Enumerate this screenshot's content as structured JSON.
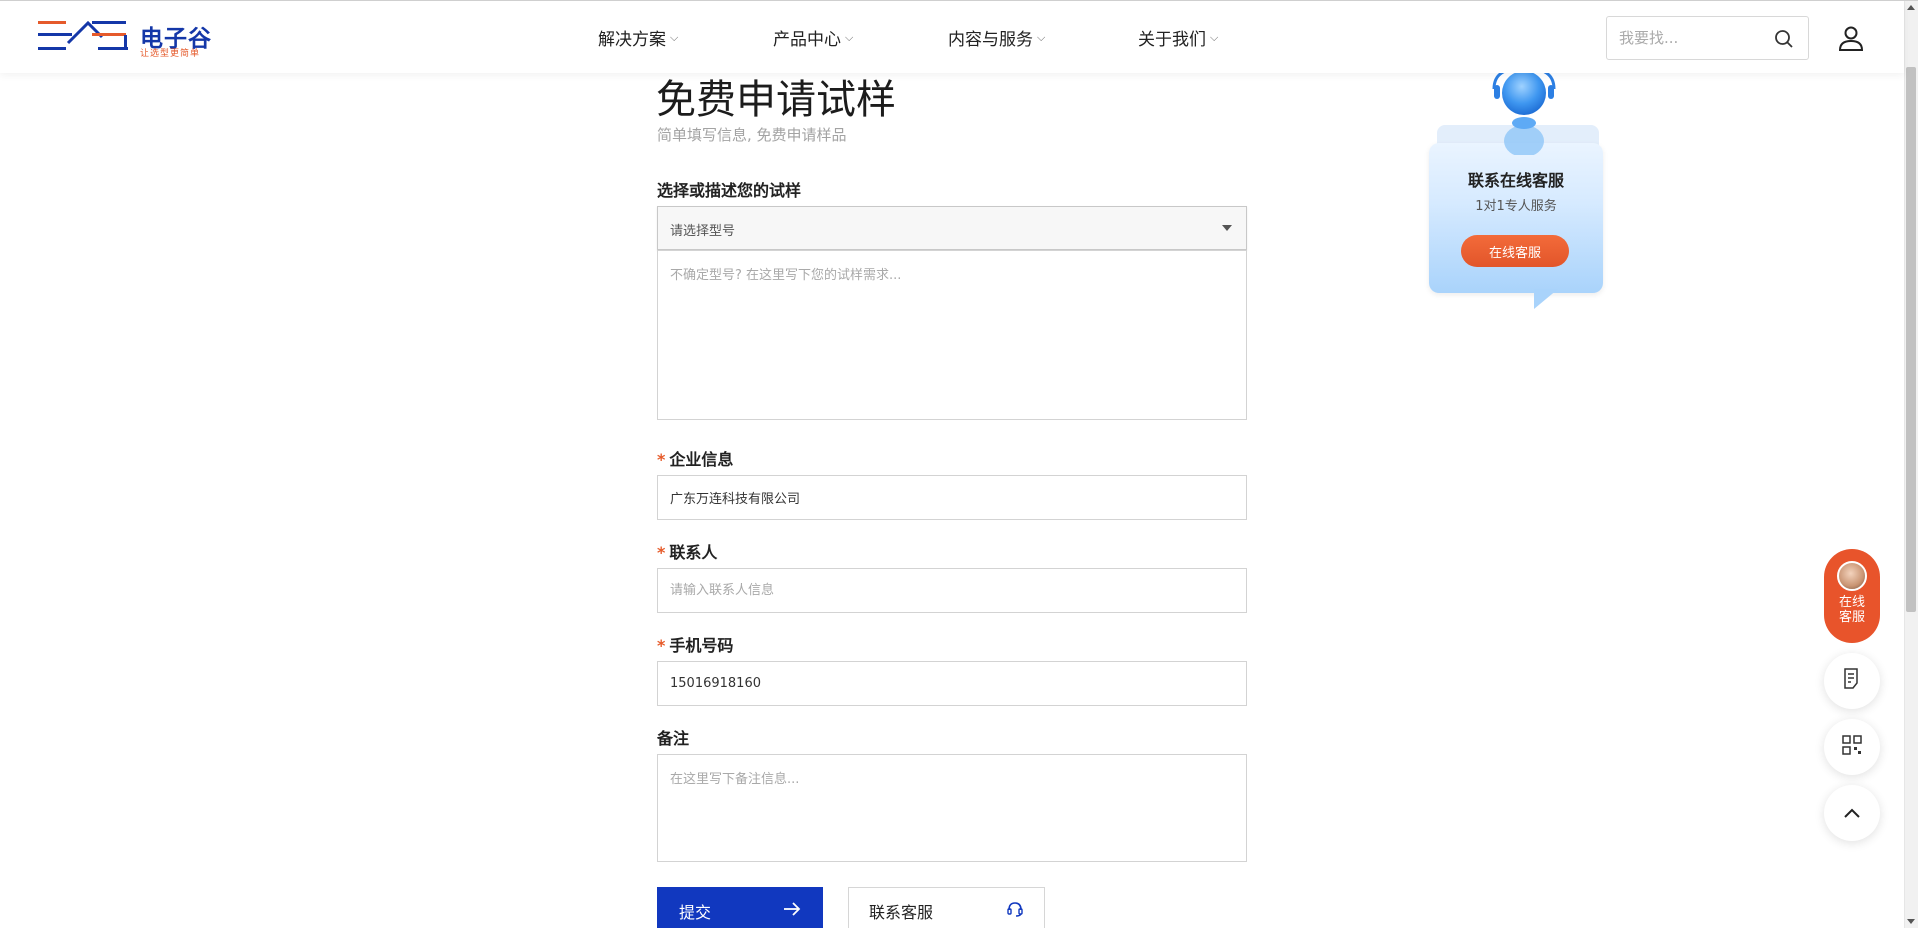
{
  "header": {
    "logo_text": "电子谷",
    "logo_slogan": "让选型更简单",
    "nav": [
      {
        "label": "解决方案"
      },
      {
        "label": "产品中心"
      },
      {
        "label": "内容与服务"
      },
      {
        "label": "关于我们"
      }
    ],
    "search": {
      "placeholder": "我要找..."
    },
    "colors": {
      "brand_blue": "#1437a8",
      "brand_orange": "#e55a2b"
    }
  },
  "main": {
    "title": "免费申请试样",
    "subtitle": "简单填写信息, 免费申请样品",
    "sample": {
      "label": "选择或描述您的试样",
      "select_value": "请选择型号",
      "textarea_placeholder": "不确定型号? 在这里写下您的试样需求..."
    },
    "company": {
      "required_mark": "*",
      "label": "企业信息",
      "value": "广东万连科技有限公司"
    },
    "contact": {
      "required_mark": "*",
      "label": "联系人",
      "placeholder": "请输入联系人信息"
    },
    "phone": {
      "required_mark": "*",
      "label": "手机号码",
      "value": "15016918160"
    },
    "remark": {
      "label": "备注",
      "placeholder": "在这里写下备注信息..."
    },
    "submit_label": "提交",
    "contact_btn_label": "联系客服"
  },
  "service_card": {
    "title": "联系在线客服",
    "subtitle": "1对1专人服务",
    "button": "在线客服"
  },
  "floating": {
    "online_label": "在线客服",
    "buttons": [
      {
        "icon": "document-icon"
      },
      {
        "icon": "qrcode-icon"
      },
      {
        "icon": "back-to-top-icon"
      }
    ]
  }
}
